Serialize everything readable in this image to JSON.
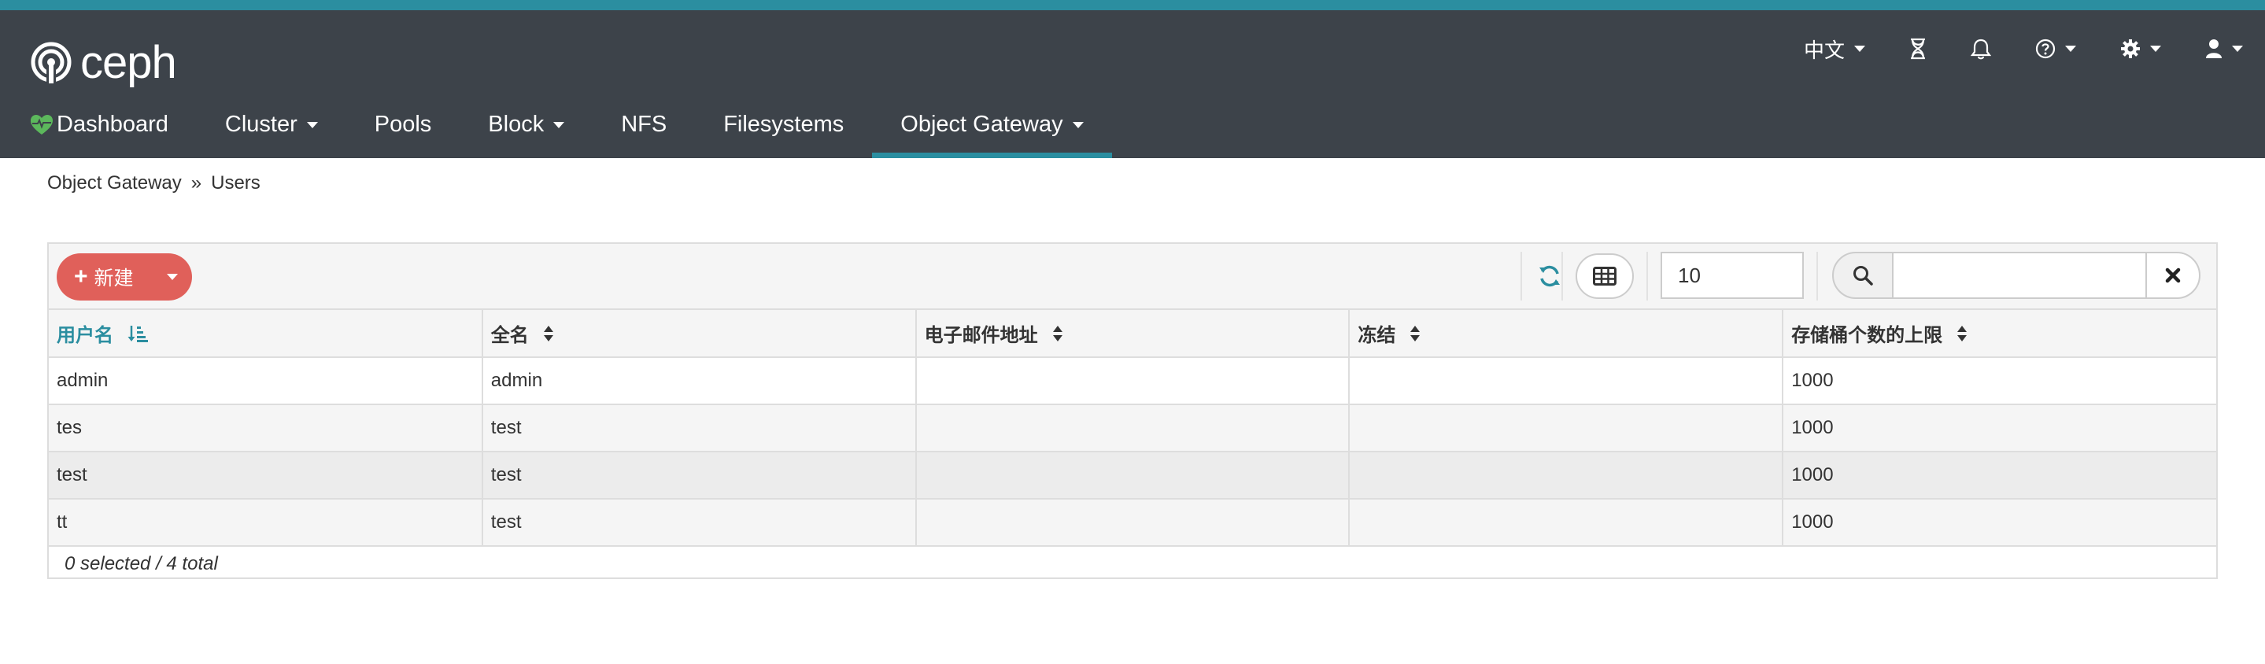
{
  "brand": {
    "name": "ceph"
  },
  "utility": {
    "language_label": "中文",
    "icons": [
      "hourglass-icon",
      "bell-icon",
      "help-icon",
      "gear-icon",
      "user-icon"
    ]
  },
  "nav": {
    "dashboard": "Dashboard",
    "cluster": "Cluster",
    "pools": "Pools",
    "block": "Block",
    "nfs": "NFS",
    "filesystems": "Filesystems",
    "object_gateway": "Object Gateway",
    "active": "Object Gateway"
  },
  "breadcrumb": {
    "parent": "Object Gateway",
    "current": "Users"
  },
  "toolbar": {
    "new_label": "新建",
    "page_size": "10",
    "search_value": ""
  },
  "table": {
    "columns": [
      "用户名",
      "全名",
      "电子邮件地址",
      "冻结",
      "存储桶个数的上限"
    ],
    "sorted_column": "用户名",
    "rows": [
      [
        "admin",
        "admin",
        "",
        "",
        "1000"
      ],
      [
        "tes",
        "test",
        "",
        "",
        "1000"
      ],
      [
        "test",
        "test",
        "",
        "",
        "1000"
      ],
      [
        "tt",
        "test",
        "",
        "",
        "1000"
      ]
    ]
  },
  "footer": {
    "summary": "0 selected / 4 total"
  },
  "colors": {
    "navbar_bg": "#3d434a",
    "accent": "#2b8ea0",
    "new_button": "#e0605a",
    "dashboard_heart": "#5cb85c"
  }
}
